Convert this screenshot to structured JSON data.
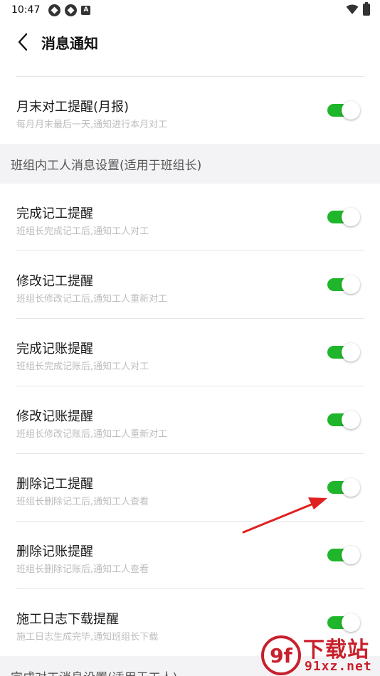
{
  "status_bar": {
    "time": "10:47",
    "app_icon_letter": "A",
    "icons": [
      "app-circle-icon",
      "app-circle-icon",
      "a-icon",
      "wifi-icon",
      "battery-icon"
    ]
  },
  "header": {
    "title": "消息通知"
  },
  "top_item": {
    "title": "月末对工提醒(月报)",
    "desc": "每月月末最后一天,通知进行本月对工",
    "enabled": true
  },
  "section_team": {
    "label": "班组内工人消息设置(适用于班组长)",
    "items": [
      {
        "title": "完成记工提醒",
        "desc": "班组长完成记工后,通知工人对工",
        "enabled": true
      },
      {
        "title": "修改记工提醒",
        "desc": "班组长修改记工后,通知工人重新对工",
        "enabled": true
      },
      {
        "title": "完成记账提醒",
        "desc": "班组长完成记账后,通知工人对工",
        "enabled": true
      },
      {
        "title": "修改记账提醒",
        "desc": "班组长修改记账后,通知工人重新对工",
        "enabled": true
      },
      {
        "title": "删除记工提醒",
        "desc": "班组长删除记工后,通知工人查看",
        "enabled": true
      },
      {
        "title": "删除记账提醒",
        "desc": "班组长删除记账后,通知工人查看",
        "enabled": true
      },
      {
        "title": "施工日志下载提醒",
        "desc": "施工日志生成完毕,通知班组长下载",
        "enabled": true
      }
    ]
  },
  "section_worker": {
    "label": "完成对工消息设置(适用于工人)"
  },
  "watermark": {
    "logo_text": "9f",
    "text": "下载站",
    "url": "91xz.net"
  },
  "colors": {
    "toggle_on": "#1fb62b",
    "section_bg": "#f3f3f5",
    "arrow": "#e02020",
    "watermark": "#c8202c"
  }
}
